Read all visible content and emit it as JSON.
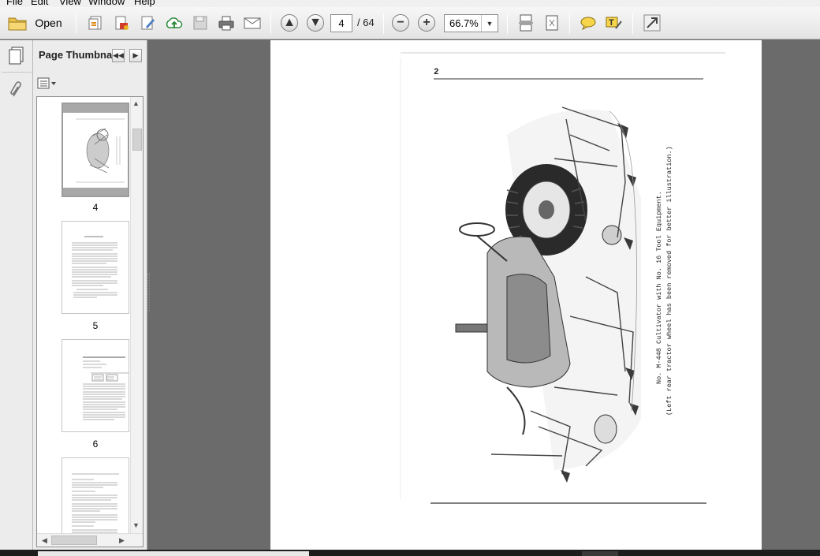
{
  "menu": {
    "file": "File",
    "edit": "Edit",
    "view": "View",
    "window": "Window",
    "help": "Help"
  },
  "toolbar": {
    "open_label": "Open",
    "page_current": "4",
    "page_total": "/ 64",
    "zoom": "66.7%"
  },
  "panel": {
    "title": "Page Thumbna...",
    "thumbnails": [
      {
        "label": "4",
        "selected": true
      },
      {
        "label": "5",
        "selected": false
      },
      {
        "label": "6",
        "selected": false
      },
      {
        "label": "",
        "selected": false
      }
    ]
  },
  "document": {
    "page_number": "2",
    "caption_line1": "No. M-448 Cultivator with No. 16 Tool Equipment.",
    "caption_line2": "(Left rear tractor wheel has been removed for better illustration.)"
  }
}
